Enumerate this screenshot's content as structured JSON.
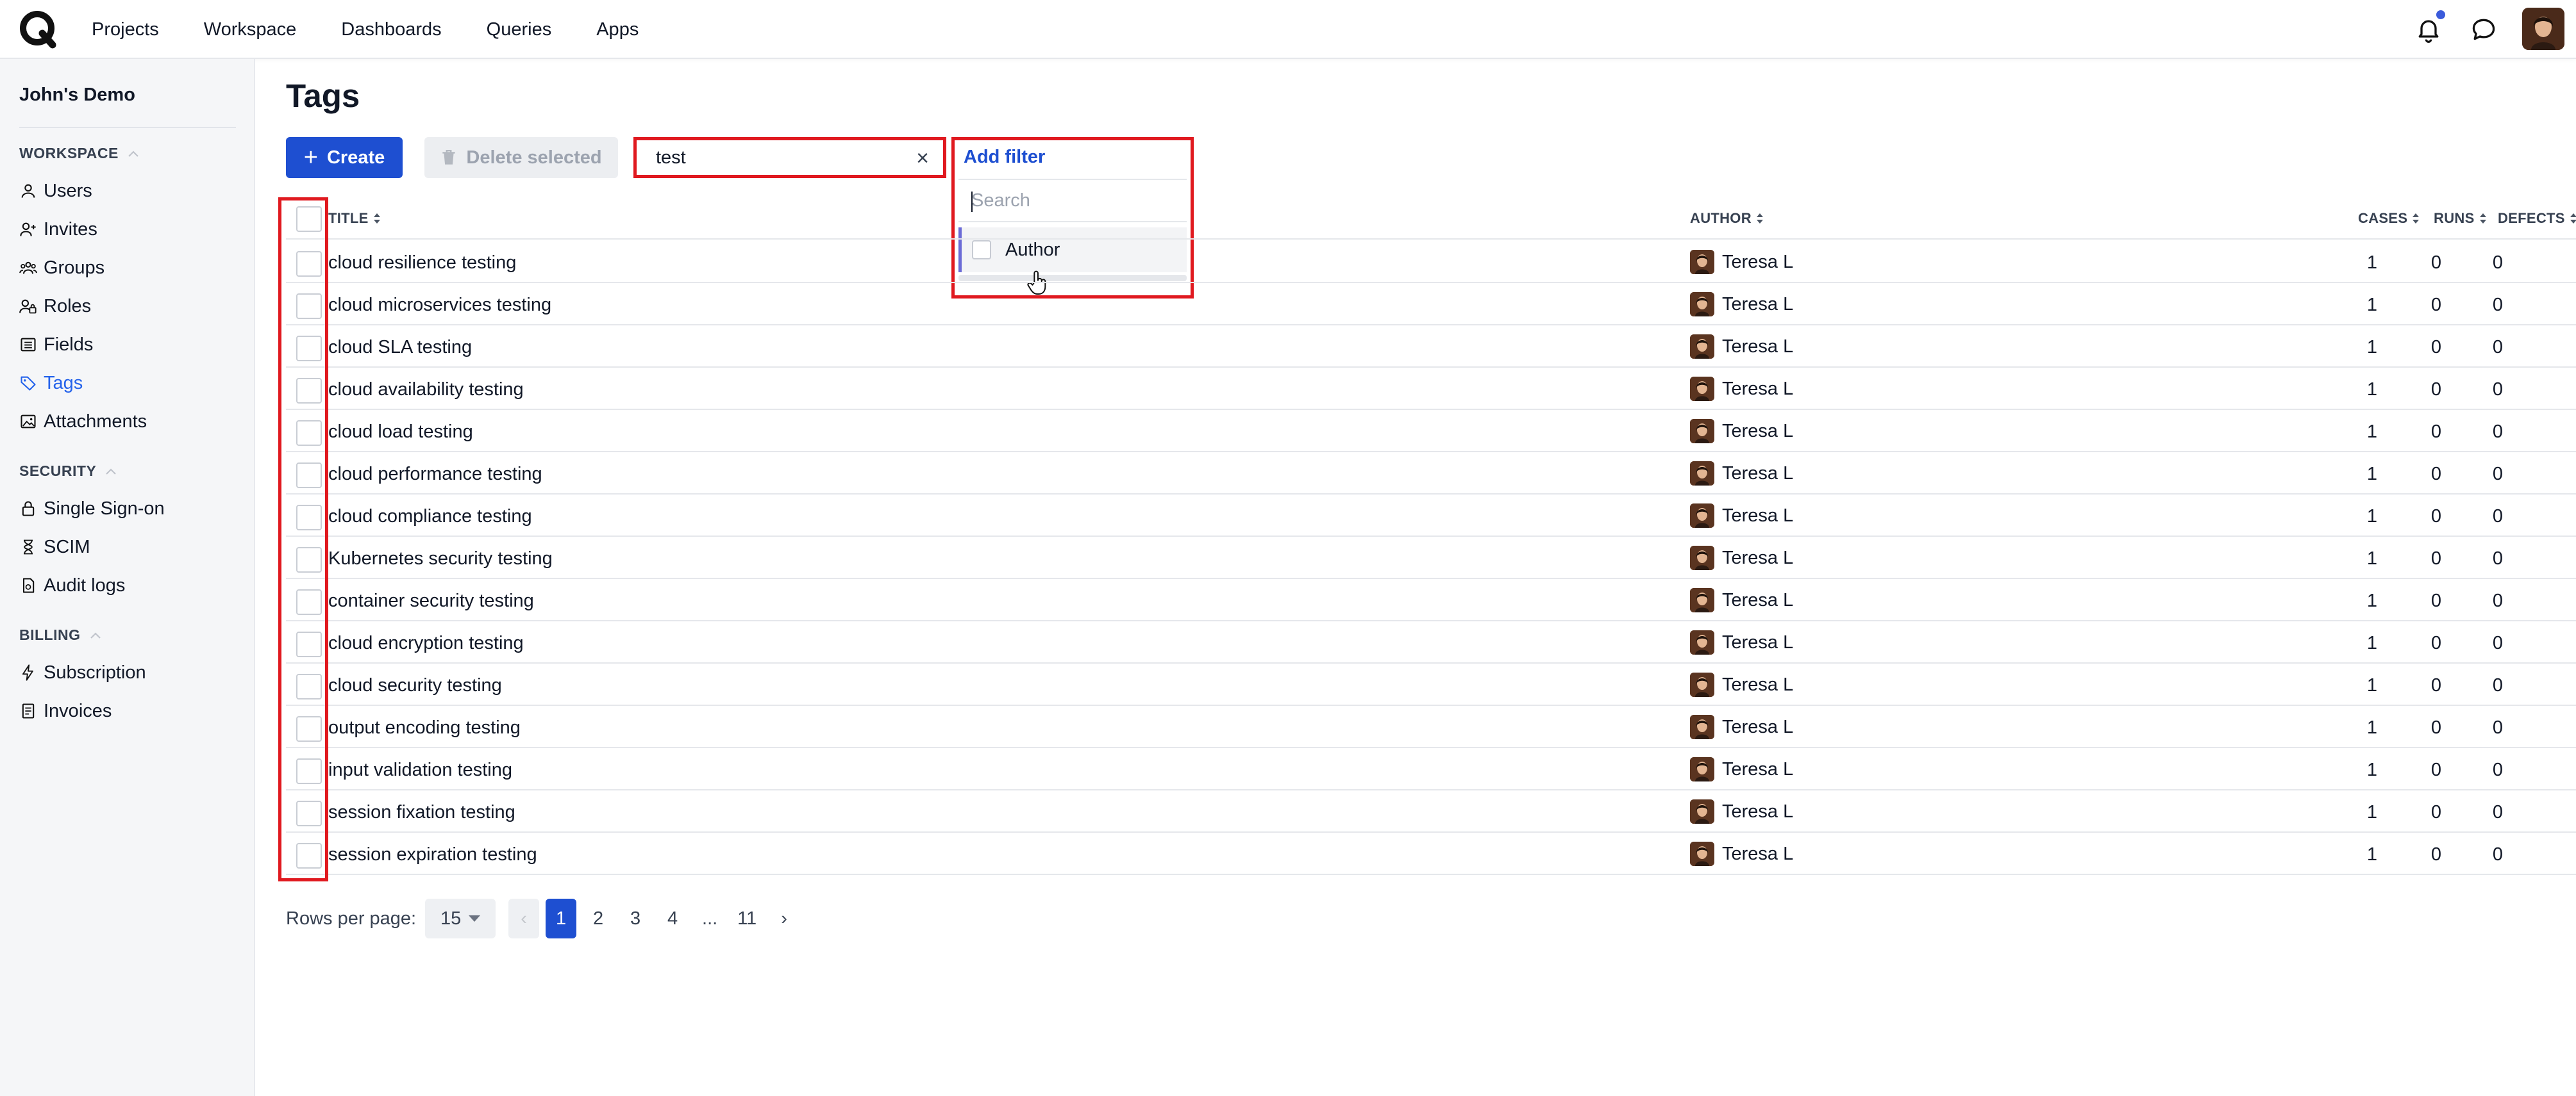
{
  "nav": {
    "items": [
      "Projects",
      "Workspace",
      "Dashboards",
      "Queries",
      "Apps"
    ]
  },
  "sidebar": {
    "org": "John's Demo",
    "sections": [
      {
        "title": "WORKSPACE",
        "items": [
          "Users",
          "Invites",
          "Groups",
          "Roles",
          "Fields",
          "Tags",
          "Attachments"
        ]
      },
      {
        "title": "SECURITY",
        "items": [
          "Single Sign-on",
          "SCIM",
          "Audit logs"
        ]
      },
      {
        "title": "BILLING",
        "items": [
          "Subscription",
          "Invoices"
        ]
      }
    ],
    "active_item": "Tags"
  },
  "page": {
    "title": "Tags"
  },
  "toolbar": {
    "create_label": "Create",
    "delete_label": "Delete selected",
    "search_value": "test"
  },
  "filter": {
    "add_label": "Add filter",
    "search_placeholder": "Search",
    "options": [
      "Author"
    ]
  },
  "table": {
    "headers": {
      "title": "TITLE",
      "author": "AUTHOR",
      "cases": "CASES",
      "runs": "RUNS",
      "defects": "DEFECTS"
    },
    "rows": [
      {
        "title": "cloud resilience testing",
        "author": "Teresa L",
        "cases": "1",
        "runs": "0",
        "defects": "0"
      },
      {
        "title": "cloud microservices testing",
        "author": "Teresa L",
        "cases": "1",
        "runs": "0",
        "defects": "0"
      },
      {
        "title": "cloud SLA testing",
        "author": "Teresa L",
        "cases": "1",
        "runs": "0",
        "defects": "0"
      },
      {
        "title": "cloud availability testing",
        "author": "Teresa L",
        "cases": "1",
        "runs": "0",
        "defects": "0"
      },
      {
        "title": "cloud load testing",
        "author": "Teresa L",
        "cases": "1",
        "runs": "0",
        "defects": "0"
      },
      {
        "title": "cloud performance testing",
        "author": "Teresa L",
        "cases": "1",
        "runs": "0",
        "defects": "0"
      },
      {
        "title": "cloud compliance testing",
        "author": "Teresa L",
        "cases": "1",
        "runs": "0",
        "defects": "0"
      },
      {
        "title": "Kubernetes security testing",
        "author": "Teresa L",
        "cases": "1",
        "runs": "0",
        "defects": "0"
      },
      {
        "title": "container security testing",
        "author": "Teresa L",
        "cases": "1",
        "runs": "0",
        "defects": "0"
      },
      {
        "title": "cloud encryption testing",
        "author": "Teresa L",
        "cases": "1",
        "runs": "0",
        "defects": "0"
      },
      {
        "title": "cloud security testing",
        "author": "Teresa L",
        "cases": "1",
        "runs": "0",
        "defects": "0"
      },
      {
        "title": "output encoding testing",
        "author": "Teresa L",
        "cases": "1",
        "runs": "0",
        "defects": "0"
      },
      {
        "title": "input validation testing",
        "author": "Teresa L",
        "cases": "1",
        "runs": "0",
        "defects": "0"
      },
      {
        "title": "session fixation testing",
        "author": "Teresa L",
        "cases": "1",
        "runs": "0",
        "defects": "0"
      },
      {
        "title": "session expiration testing",
        "author": "Teresa L",
        "cases": "1",
        "runs": "0",
        "defects": "0"
      }
    ]
  },
  "pagination": {
    "rows_per_page_label": "Rows per page:",
    "rows_per_page_value": "15",
    "prev": "‹",
    "pages": [
      "1",
      "2",
      "3",
      "4",
      "...",
      "11"
    ],
    "current": "1",
    "next": "›"
  },
  "colors": {
    "accent": "#1e4fd1",
    "highlight": "#e0191f",
    "active_nav": "#2563eb"
  }
}
